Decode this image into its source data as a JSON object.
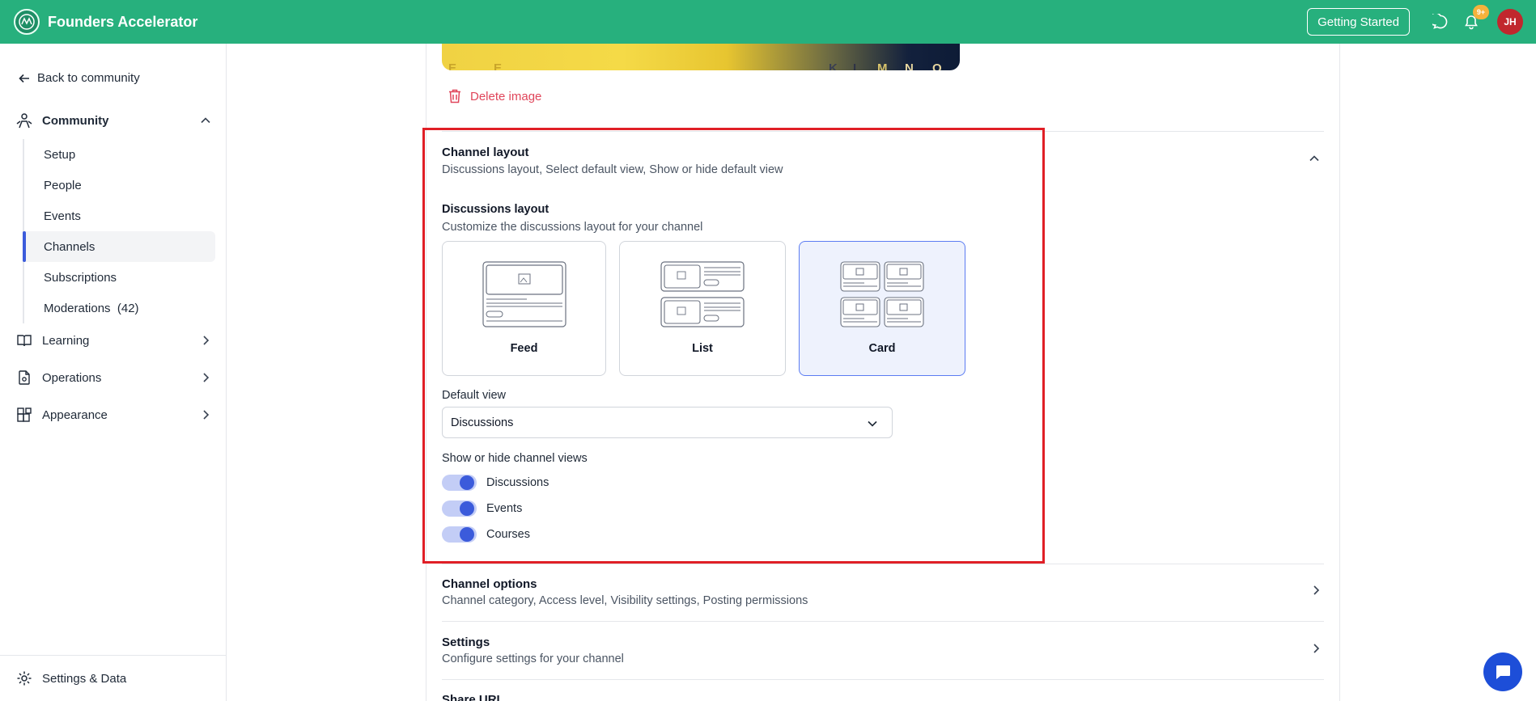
{
  "topbar": {
    "brand_name": "Founders Accelerator",
    "getting_started_label": "Getting Started",
    "notification_badge": "9+",
    "avatar_initials": "JH",
    "accent_color": "#27b07d"
  },
  "sidebar": {
    "back_label": "Back to community",
    "community_label": "Community",
    "community_items": [
      {
        "label": "Setup"
      },
      {
        "label": "People"
      },
      {
        "label": "Events"
      },
      {
        "label": "Channels",
        "active": true
      },
      {
        "label": "Subscriptions"
      },
      {
        "label": "Moderations  (42)"
      }
    ],
    "learning_label": "Learning",
    "operations_label": "Operations",
    "appearance_label": "Appearance",
    "footer_label": "Settings & Data"
  },
  "main": {
    "image_strip_letters": [
      "E",
      "E",
      "K",
      "L",
      "M",
      "N",
      "O"
    ],
    "delete_image_label": "Delete image",
    "channel_layout": {
      "title": "Channel layout",
      "subtitle": "Discussions layout, Select default view, Show or hide default view",
      "discussions_layout_title": "Discussions layout",
      "discussions_layout_sub": "Customize the discussions layout for your channel",
      "layout_options": [
        {
          "label": "Feed",
          "selected": false
        },
        {
          "label": "List",
          "selected": false
        },
        {
          "label": "Card",
          "selected": true
        }
      ],
      "default_view_label": "Default view",
      "default_view_value": "Discussions",
      "show_hide_title": "Show or hide channel views",
      "views": [
        {
          "label": "Discussions",
          "enabled": true
        },
        {
          "label": "Events",
          "enabled": true
        },
        {
          "label": "Courses",
          "enabled": true
        }
      ]
    },
    "channel_options": {
      "title": "Channel options",
      "subtitle": "Channel category, Access level, Visibility settings, Posting permissions"
    },
    "settings": {
      "title": "Settings",
      "subtitle": "Configure settings for your channel"
    },
    "share_url": {
      "title": "Share URL"
    }
  }
}
